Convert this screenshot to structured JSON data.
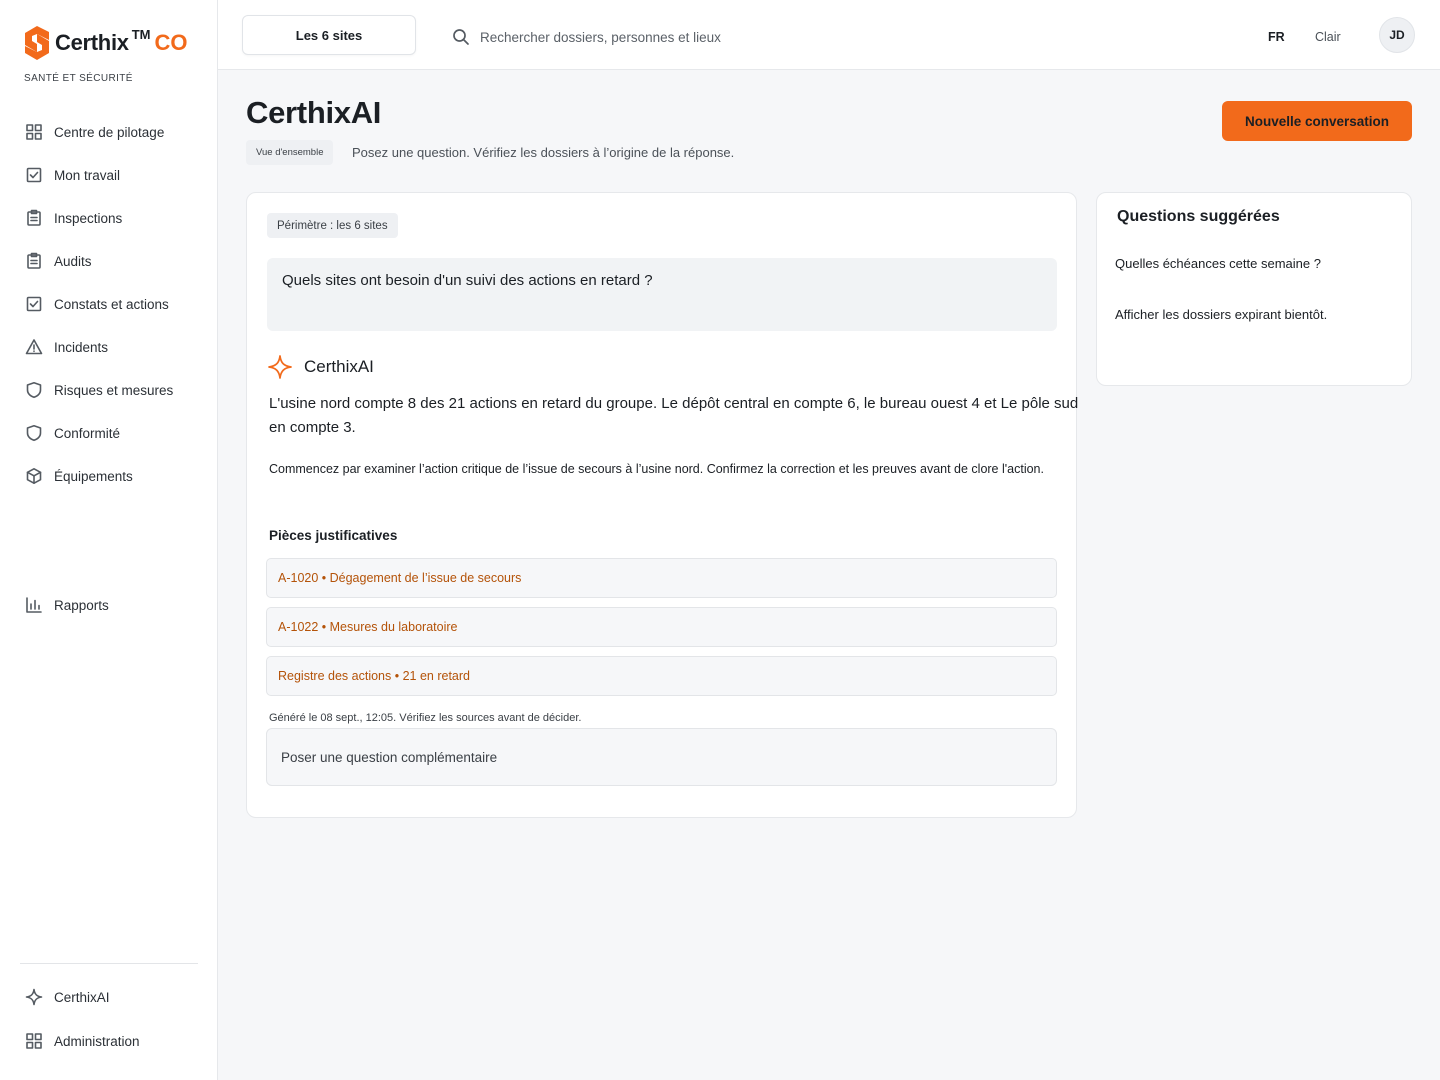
{
  "brand": {
    "name": "Certhix",
    "tm": "TM",
    "suffix": "CO",
    "tagline": "SANTÉ ET SÉCURITÉ"
  },
  "sidebar": {
    "items": [
      {
        "label": "Centre de pilotage",
        "icon": "grid-icon"
      },
      {
        "label": "Mon travail",
        "icon": "checkbox-icon"
      },
      {
        "label": "Inspections",
        "icon": "clipboard-icon"
      },
      {
        "label": "Audits",
        "icon": "clipboard-icon"
      },
      {
        "label": "Constats et actions",
        "icon": "checkbox-icon"
      },
      {
        "label": "Incidents",
        "icon": "warning-icon"
      },
      {
        "label": "Risques et mesures",
        "icon": "shield-icon"
      },
      {
        "label": "Conformité",
        "icon": "shield-icon"
      },
      {
        "label": "Équipements",
        "icon": "box-icon"
      },
      {
        "label": "Rapports",
        "icon": "bar-chart-icon"
      }
    ],
    "bottom": [
      {
        "label": "CerthixAI",
        "icon": "sparkle-icon"
      },
      {
        "label": "Administration",
        "icon": "grid-icon"
      }
    ]
  },
  "topbar": {
    "site_selector": "Les 6 sites",
    "search_placeholder": "Rechercher dossiers, personnes et lieux",
    "language": "FR",
    "theme": "Clair",
    "avatar": "JD"
  },
  "page": {
    "title": "CerthixAI",
    "breadcrumb": "Vue d'ensemble",
    "subtitle": "Posez une question. Vérifiez les dossiers à l’origine de la réponse.",
    "new_conversation": "Nouvelle conversation"
  },
  "chat": {
    "scope": "Périmètre : les 6 sites",
    "question": "Quels sites ont besoin d'un suivi des actions en retard ?",
    "assistant_name": "CerthixAI",
    "answer": "L'usine nord compte 8 des 21 actions en retard du groupe. Le dépôt central en compte 6, le bureau ouest 4 et Le pôle sud en compte 3.",
    "detail": "Commencez par examiner l’action critique de l’issue de secours à l’usine nord. Confirmez la correction et les preuves avant de clore l'action.",
    "evidence_title": "Pièces justificatives",
    "evidence": [
      "A-1020 • Dégagement de l’issue de secours",
      "A-1022 • Mesures du laboratoire",
      "Registre des actions • 21 en retard"
    ],
    "generated": "Généré le 08 sept., 12:05. Vérifiez les sources avant de décider.",
    "followup_placeholder": "Poser une question complémentaire"
  },
  "suggestions": {
    "title": "Questions suggérées",
    "items": [
      "Quelles échéances cette semaine ?",
      "Afficher les dossiers expirant bientôt."
    ]
  },
  "colors": {
    "accent": "#f26a1b",
    "evidence_link": "#b45309"
  }
}
